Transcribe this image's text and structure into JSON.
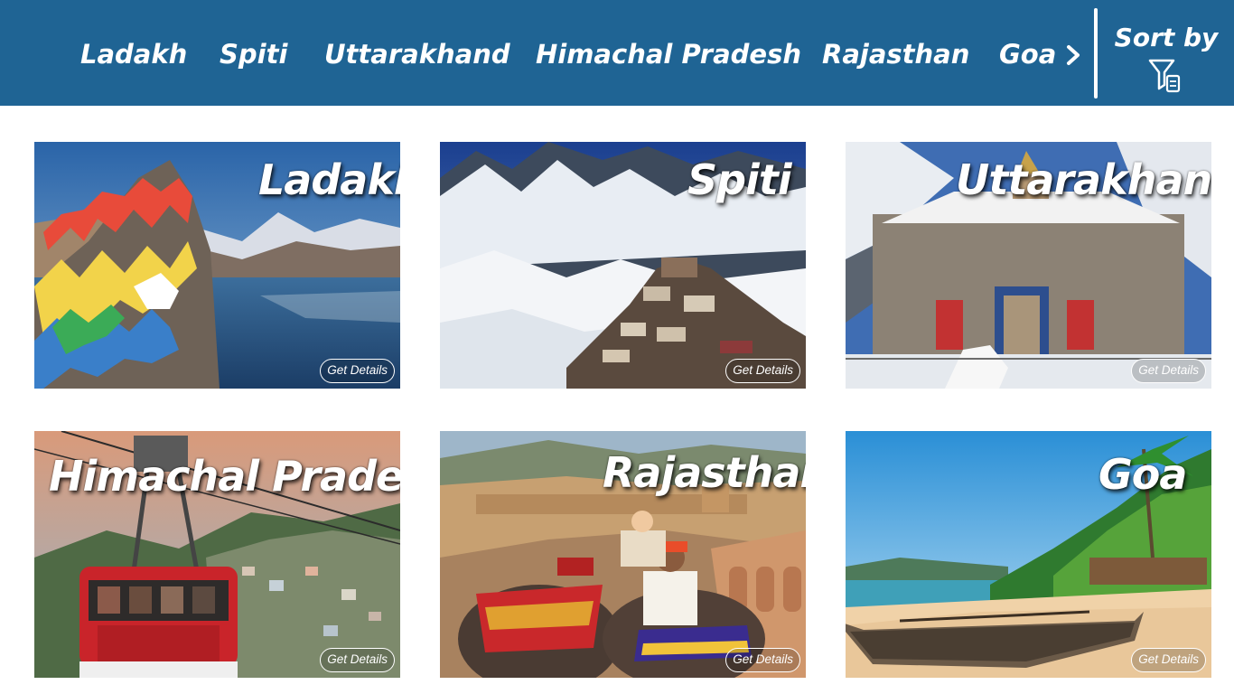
{
  "nav": {
    "items": [
      {
        "label": "Ladakh"
      },
      {
        "label": "Spiti"
      },
      {
        "label": "Uttarakhand"
      },
      {
        "label": "Himachal Pradesh"
      },
      {
        "label": "Rajasthan"
      },
      {
        "label": "Goa"
      }
    ],
    "next_icon": "chevron-right-icon",
    "sort_label": "Sort by",
    "sort_icon": "filter-icon"
  },
  "cards": [
    {
      "title": "Ladakh",
      "button": "Get Details"
    },
    {
      "title": "Spiti",
      "button": "Get Details"
    },
    {
      "title": "Uttarakhand",
      "button": "Get Details"
    },
    {
      "title": "Himachal Pradesh",
      "button": "Get Details"
    },
    {
      "title": "Rajasthan",
      "button": "Get Details"
    },
    {
      "title": "Goa",
      "button": "Get Details"
    }
  ],
  "colors": {
    "header": "#1f6494",
    "text": "#ffffff"
  }
}
